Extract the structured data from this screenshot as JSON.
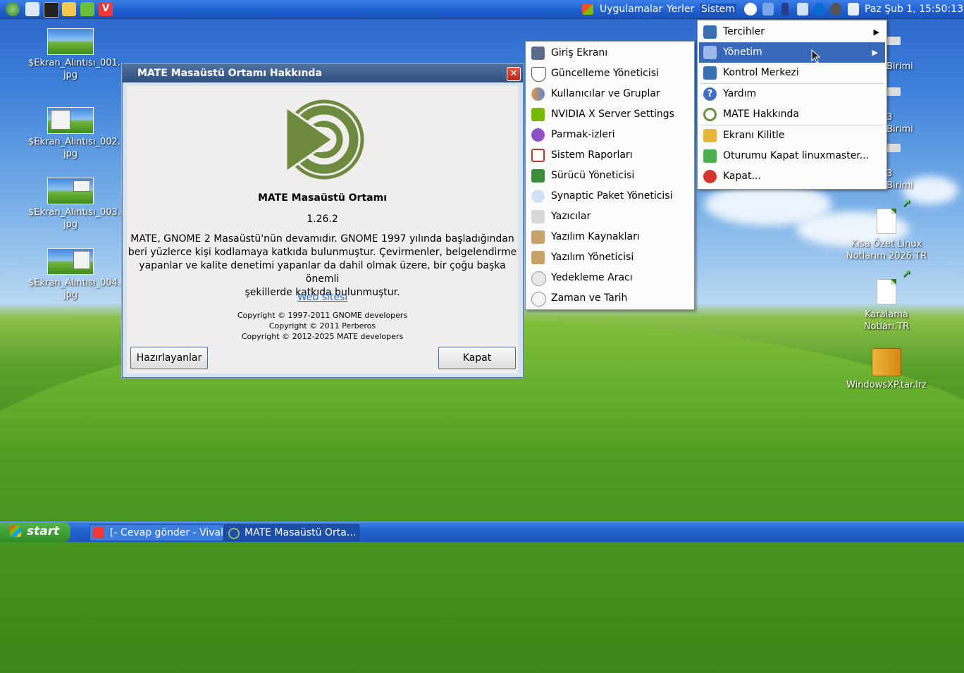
{
  "top_panel": {
    "menus": [
      "Uygulamalar",
      "Yerler",
      "Sistem"
    ],
    "clock": "Paz Şub  1, 15:50:13"
  },
  "desktop": {
    "left_icons": [
      {
        "line1": "$Ekran_Alıntısı_001.",
        "line2": "jpg"
      },
      {
        "line1": "$Ekran_Alıntısı_002.",
        "line2": "jpg"
      },
      {
        "line1": "$Ekran_Alıntısı_003.",
        "line2": "jpg"
      },
      {
        "line1": "$Ekran_Alıntısı_004.",
        "line2": "jpg"
      }
    ],
    "right_icons": [
      {
        "line1": "Kısa Özet Linux",
        "line2": "Notlarım 2026.TR"
      },
      {
        "line1": "Karalama Notları.TR",
        "line2": ""
      },
      {
        "line1": "WindowsXP.tar.lrz",
        "line2": ""
      }
    ],
    "partial_drive_labels": [
      "Birimi",
      "3 Birimi",
      "3 Birimi"
    ]
  },
  "about_dialog": {
    "title": "MATE Masaüstü Ortamı Hakkında",
    "app_name": "MATE Masaüstü Ortamı",
    "version": "1.26.2",
    "description_lines": [
      "MATE, GNOME 2 Masaüstü'nün devamıdır. GNOME 1997 yılında başladığından",
      "beri yüzlerce kişi kodlamaya katkıda bulunmuştur. Çevirmenler, belgelendirme",
      "yapanlar ve kalite denetimi yapanlar da dahil olmak üzere, bir çoğu başka önemli",
      "şekillerde katkıda bulunmuştur."
    ],
    "website_link": "Web sitesi",
    "copyright_lines": [
      "Copyright © 1997-2011 GNOME developers",
      "Copyright © 2011 Perberos",
      "Copyright © 2012-2025 MATE developers"
    ],
    "credits_button": "Hazırlayanlar",
    "close_button": "Kapat"
  },
  "system_menu": {
    "items": [
      "Tercihler",
      "Yönetim",
      "Kontrol Merkezi",
      "Yardım",
      "MATE Hakkında",
      "Ekranı Kilitle",
      "Oturumu Kapat linuxmaster...",
      "Kapat..."
    ]
  },
  "admin_submenu": {
    "items": [
      "Giriş Ekranı",
      "Güncelleme Yöneticisi",
      "Kullanıcılar ve Gruplar",
      "NVIDIA X Server Settings",
      "Parmak-izleri",
      "Sistem Raporları",
      "Sürücü Yöneticisi",
      "Synaptic Paket Yöneticisi",
      "Yazıcılar",
      "Yazılım Kaynakları",
      "Yazılım Yöneticisi",
      "Yedekleme Aracı",
      "Zaman ve Tarih"
    ]
  },
  "taskbar": {
    "start_label": "start",
    "tasks": [
      "[- Cevap gönder - Vival...",
      "MATE Masaüstü Orta..."
    ]
  }
}
